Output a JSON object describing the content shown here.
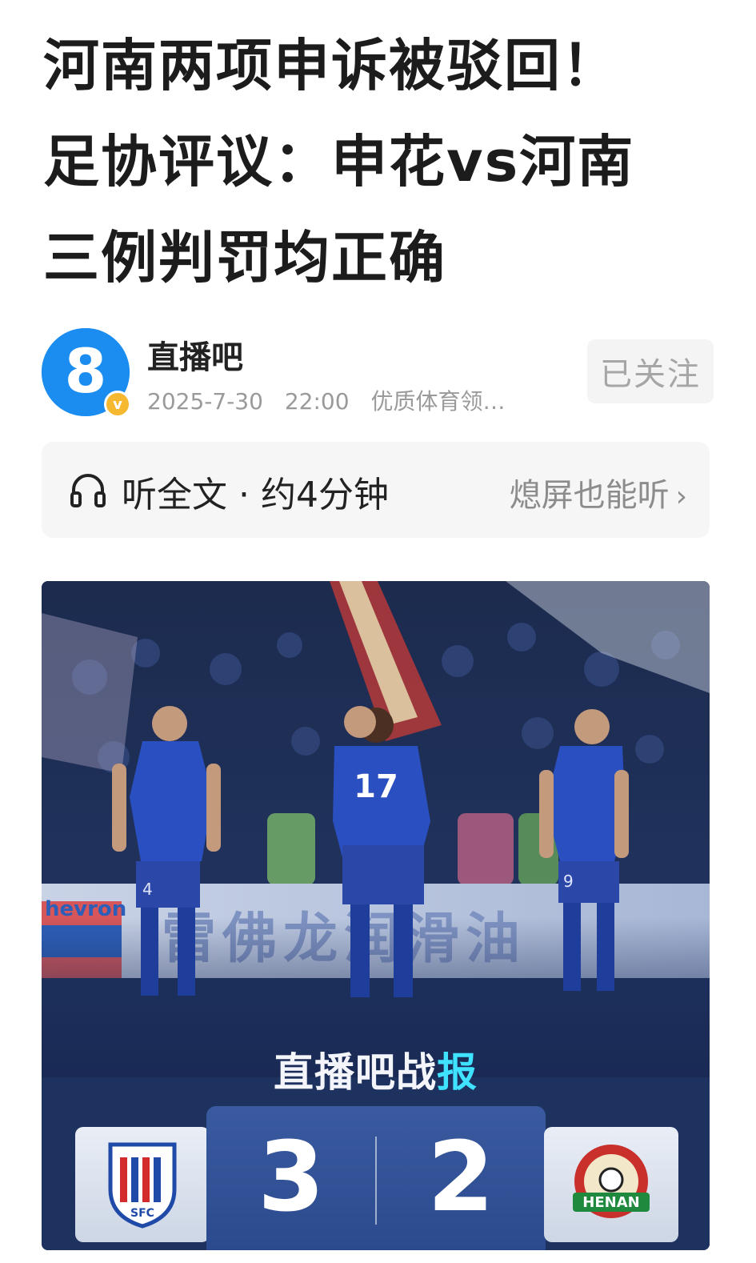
{
  "article": {
    "title_lines": [
      "河南两项申诉被驳回！",
      "足协评议：申花vs河南",
      "三例判罚均正确"
    ]
  },
  "author": {
    "name": "直播吧",
    "date": "2025-7-30",
    "time": "22:00",
    "tag": "优质体育领…",
    "follow_label": "已关注",
    "avatar_glyph": "8",
    "verified_glyph": "v"
  },
  "listen": {
    "label": "听全文 · 约4分钟",
    "right_label": "熄屏也能听",
    "chevron": "›",
    "icon": "headphones-icon"
  },
  "hero": {
    "report_title_a": "直播吧战",
    "report_title_zap": "报",
    "home_score": "3",
    "away_score": "2",
    "ad_board_text": "雷佛龙润滑油",
    "ad_brand": "hevron",
    "jersey_numbers": [
      "4",
      "17",
      "9"
    ],
    "away_badge_text": "HENAN",
    "home_badge_text": "SFC",
    "colors": {
      "jersey": "#2a4fc0",
      "pitch_overlay": "#1a2a55",
      "score_panel": "#3a5aa0",
      "accent_bolt": "#3fe2ff"
    }
  }
}
